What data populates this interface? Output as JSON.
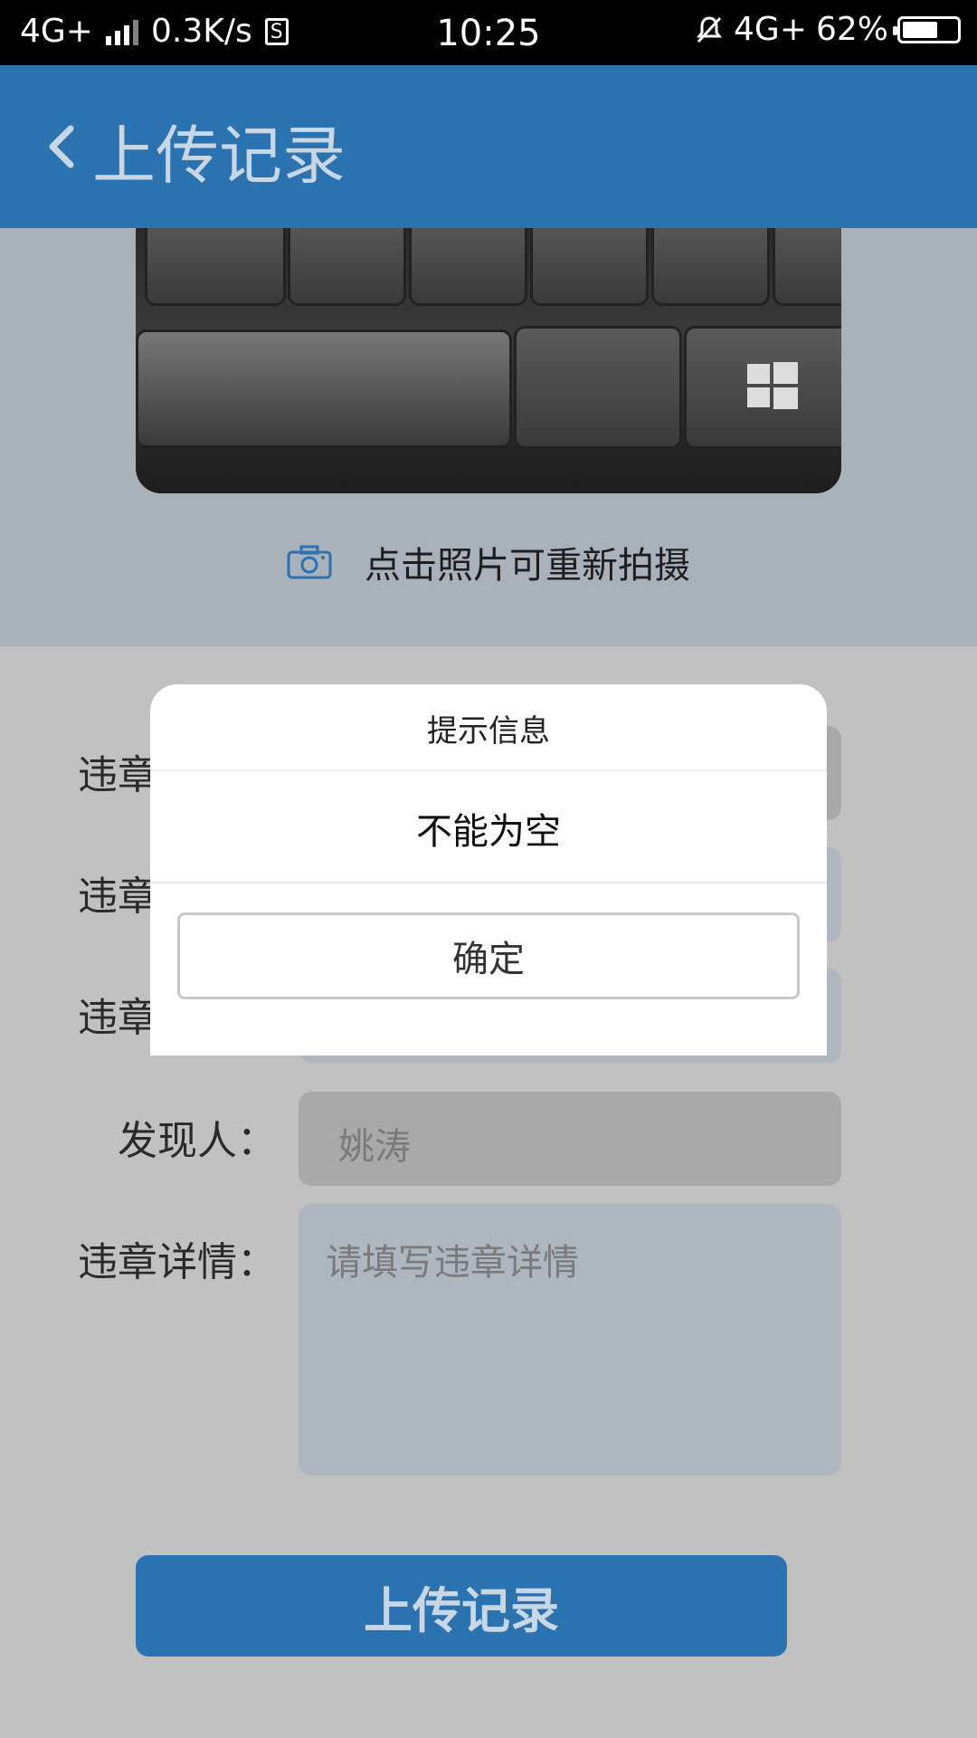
{
  "status_bar": {
    "network": "4G+",
    "speed": "0.3K/s",
    "sim_icon_label": "S",
    "time": "10:25",
    "network_right": "4G+",
    "battery": "62%"
  },
  "header": {
    "title": "上传记录"
  },
  "photo_section": {
    "retake_hint": "点击照片可重新拍摄"
  },
  "form": {
    "hidden_label_1": "违章",
    "hidden_label_2": "违章",
    "hidden_label_3": "违章",
    "finder_label": "发现人：",
    "finder_value": "姚涛",
    "details_label": "违章详情：",
    "details_placeholder": "请填写违章详情",
    "submit_label": "上传记录"
  },
  "dialog": {
    "title": "提示信息",
    "message": "不能为空",
    "confirm_label": "确定"
  },
  "colors": {
    "primary": "#2b72b1",
    "overlay": "#c1c1c1"
  }
}
